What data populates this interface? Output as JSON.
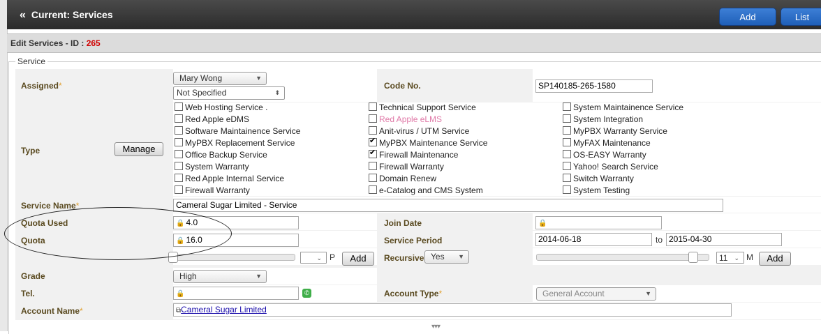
{
  "header": {
    "title": "Current: Services",
    "add_label": "Add",
    "list_label": "List"
  },
  "subheader": {
    "prefix": "Edit Services - ID : ",
    "id": "265"
  },
  "legend": "Service",
  "labels": {
    "assigned": "Assigned",
    "code_no": "Code No.",
    "type": "Type",
    "service_name": "Service Name",
    "quota_used": "Quota Used",
    "join_date": "Join Date",
    "quota": "Quota",
    "service_period": "Service Period",
    "recursive": "Recursive",
    "grade": "Grade",
    "tel": "Tel.",
    "account_type": "Account Type",
    "account_name": "Account Name"
  },
  "assigned": {
    "user": "Mary Wong",
    "specified": "Not Specified"
  },
  "code_no": "SP140185-265-1580",
  "manage_label": "Manage",
  "types": {
    "col1": [
      {
        "label": "Web Hosting Service .",
        "checked": false
      },
      {
        "label": "Red Apple eDMS",
        "checked": false
      },
      {
        "label": "Software Maintainence Service",
        "checked": false
      },
      {
        "label": "MyPBX Replacement Service",
        "checked": false
      },
      {
        "label": "Office Backup Service",
        "checked": false
      },
      {
        "label": "System Warranty",
        "checked": false
      },
      {
        "label": "Red Apple Internal Service",
        "checked": false
      },
      {
        "label": "Firewall Warranty",
        "checked": false
      }
    ],
    "col2": [
      {
        "label": "Technical Support Service",
        "checked": false
      },
      {
        "label": "Red Apple eLMS",
        "checked": false
      },
      {
        "label": "Anit-virus / UTM Service",
        "checked": false
      },
      {
        "label": "MyPBX Maintenance Service",
        "checked": true
      },
      {
        "label": "Firewall Maintenance",
        "checked": true
      },
      {
        "label": "Firewall Warranty",
        "checked": false
      },
      {
        "label": "Domain Renew",
        "checked": false
      },
      {
        "label": "e-Catalog and CMS System",
        "checked": false
      }
    ],
    "col3": [
      {
        "label": "System Maintainence Service",
        "checked": false
      },
      {
        "label": "System Integration",
        "checked": false
      },
      {
        "label": "MyPBX Warranty Service",
        "checked": false
      },
      {
        "label": "MyFAX Maintenance",
        "checked": false
      },
      {
        "label": "OS-EASY Warranty",
        "checked": false
      },
      {
        "label": "Yahoo! Search Service",
        "checked": false
      },
      {
        "label": "Switch Warranty",
        "checked": false
      },
      {
        "label": "System Testing",
        "checked": false
      }
    ]
  },
  "service_name": "Cameral Sugar Limited - Service",
  "quota_used": "4.0",
  "quota": "16.0",
  "service_period": {
    "from": "2014-06-18",
    "to_label": "to",
    "to": "2015-04-30"
  },
  "quota_adjust": {
    "unit": "P",
    "add_label": "Add"
  },
  "recursive": {
    "value": "Yes",
    "months": "11",
    "unit": "M",
    "add_label": "Add"
  },
  "grade": "High",
  "account_type": "General Account",
  "account_name": "Cameral Sugar Limited",
  "footer_mark": "▾▾▾"
}
